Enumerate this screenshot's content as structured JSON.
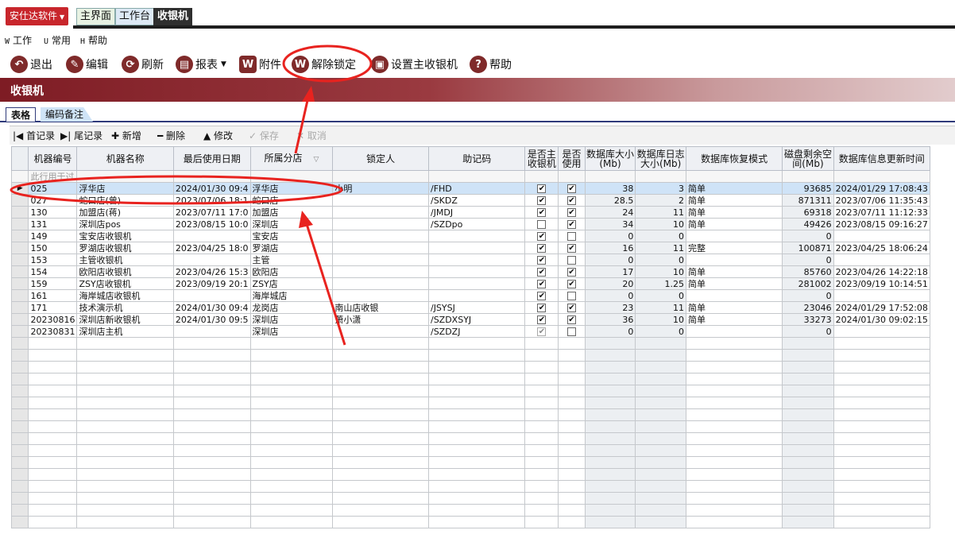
{
  "app": {
    "brand": "安仕达软件"
  },
  "top_tabs": [
    "主界面",
    "工作台",
    "收银机"
  ],
  "menu": [
    {
      "key": "W",
      "label": "工作"
    },
    {
      "key": "U",
      "label": "常用"
    },
    {
      "key": "H",
      "label": "帮助"
    }
  ],
  "toolbar": {
    "exit": "退出",
    "edit": "编辑",
    "refresh": "刷新",
    "report": "报表",
    "attach": "附件",
    "unlock": "解除锁定",
    "set_main": "设置主收银机",
    "help": "帮助"
  },
  "page_title": "收银机",
  "sub_tabs": [
    "表格",
    "编码备注"
  ],
  "grid_tools": {
    "first": "首记录",
    "last": "尾记录",
    "add": "新增",
    "delete": "删除",
    "modify": "修改",
    "save": "保存",
    "cancel": "取消"
  },
  "columns": [
    "机器编号",
    "机器名称",
    "最后使用日期",
    "所属分店",
    "锁定人",
    "助记码",
    "是否主收银机",
    "是否使用",
    "数据库大小(Mb)",
    "数据库日志大小(Mb)",
    "数据库恢复模式",
    "磁盘剩余空间(Mb)",
    "数据库信息更新时间"
  ],
  "filter_row_text": "此行用于过",
  "rows": [
    {
      "id": "025",
      "name": "浮华店",
      "last_used": "2024/01/30 09:4",
      "branch": "浮华店",
      "locker": "小明",
      "code": "/FHD",
      "main": true,
      "used": true,
      "db_size": "38",
      "log_size": "3",
      "mode": "简单",
      "disk": "93685",
      "updated": "2024/01/29 17:08:43"
    },
    {
      "id": "027",
      "name": "蛇口店(曾)",
      "last_used": "2023/07/06 18:1",
      "branch": "蛇口店",
      "locker": "",
      "code": "/SKDZ",
      "main": true,
      "used": true,
      "db_size": "28.5",
      "log_size": "2",
      "mode": "简单",
      "disk": "871311",
      "updated": "2023/07/06 11:35:43"
    },
    {
      "id": "130",
      "name": "加盟店(蒋)",
      "last_used": "2023/07/11 17:0",
      "branch": "加盟店",
      "locker": "",
      "code": "/JMDJ",
      "main": true,
      "used": true,
      "db_size": "24",
      "log_size": "11",
      "mode": "简单",
      "disk": "69318",
      "updated": "2023/07/11 11:12:33"
    },
    {
      "id": "131",
      "name": "深圳店pos",
      "last_used": "2023/08/15 10:0",
      "branch": "深圳店",
      "locker": "",
      "code": "/SZDpo",
      "main": false,
      "used": true,
      "db_size": "34",
      "log_size": "10",
      "mode": "简单",
      "disk": "49426",
      "updated": "2023/08/15 09:16:27"
    },
    {
      "id": "149",
      "name": "宝安店收银机",
      "last_used": "",
      "branch": "宝安店",
      "locker": "",
      "code": "",
      "main": true,
      "used": false,
      "db_size": "0",
      "log_size": "0",
      "mode": "",
      "disk": "0",
      "updated": ""
    },
    {
      "id": "150",
      "name": "罗湖店收银机",
      "last_used": "2023/04/25 18:0",
      "branch": "罗湖店",
      "locker": "",
      "code": "",
      "main": true,
      "used": true,
      "db_size": "16",
      "log_size": "11",
      "mode": "完整",
      "disk": "100871",
      "updated": "2023/04/25 18:06:24"
    },
    {
      "id": "153",
      "name": "主管收银机",
      "last_used": "",
      "branch": "主管",
      "locker": "",
      "code": "",
      "main": true,
      "used": false,
      "db_size": "0",
      "log_size": "0",
      "mode": "",
      "disk": "0",
      "updated": ""
    },
    {
      "id": "154",
      "name": "欧阳店收银机",
      "last_used": "2023/04/26 15:3",
      "branch": "欧阳店",
      "locker": "",
      "code": "",
      "main": true,
      "used": true,
      "db_size": "17",
      "log_size": "10",
      "mode": "简单",
      "disk": "85760",
      "updated": "2023/04/26 14:22:18"
    },
    {
      "id": "159",
      "name": "ZSY店收银机",
      "last_used": "2023/09/19 20:1",
      "branch": "ZSY店",
      "locker": "",
      "code": "",
      "main": true,
      "used": true,
      "db_size": "20",
      "log_size": "1.25",
      "mode": "简单",
      "disk": "281002",
      "updated": "2023/09/19 10:14:51"
    },
    {
      "id": "161",
      "name": "海岸城店收银机",
      "last_used": "",
      "branch": "海岸城店",
      "locker": "",
      "code": "",
      "main": true,
      "used": false,
      "db_size": "0",
      "log_size": "0",
      "mode": "",
      "disk": "0",
      "updated": ""
    },
    {
      "id": "171",
      "name": "技术演示机",
      "last_used": "2024/01/30 09:4",
      "branch": "龙岗店",
      "locker": "南山店收银",
      "code": "/JSYSJ",
      "main": true,
      "used": true,
      "db_size": "23",
      "log_size": "11",
      "mode": "简单",
      "disk": "23046",
      "updated": "2024/01/29 17:52:08"
    },
    {
      "id": "20230816",
      "name": "深圳店新收银机",
      "last_used": "2024/01/30 09:5",
      "branch": "深圳店",
      "locker": "萧小潇",
      "code": "/SZDXSYJ",
      "main": true,
      "used": true,
      "db_size": "36",
      "log_size": "10",
      "mode": "简单",
      "disk": "33273",
      "updated": "2024/01/30 09:02:15"
    },
    {
      "id": "20230831",
      "name": "深圳店主机",
      "last_used": "",
      "branch": "深圳店",
      "locker": "",
      "code": "/SZDZJ",
      "main": true,
      "used": false,
      "db_size": "0",
      "log_size": "0",
      "mode": "",
      "disk": "0",
      "updated": ""
    }
  ],
  "empty_rows": 16,
  "colors": {
    "brand": "#c8262c",
    "title_bar": "#7e1c24",
    "annotation": "#e8231f",
    "selected_row": "#cfe3f7"
  }
}
